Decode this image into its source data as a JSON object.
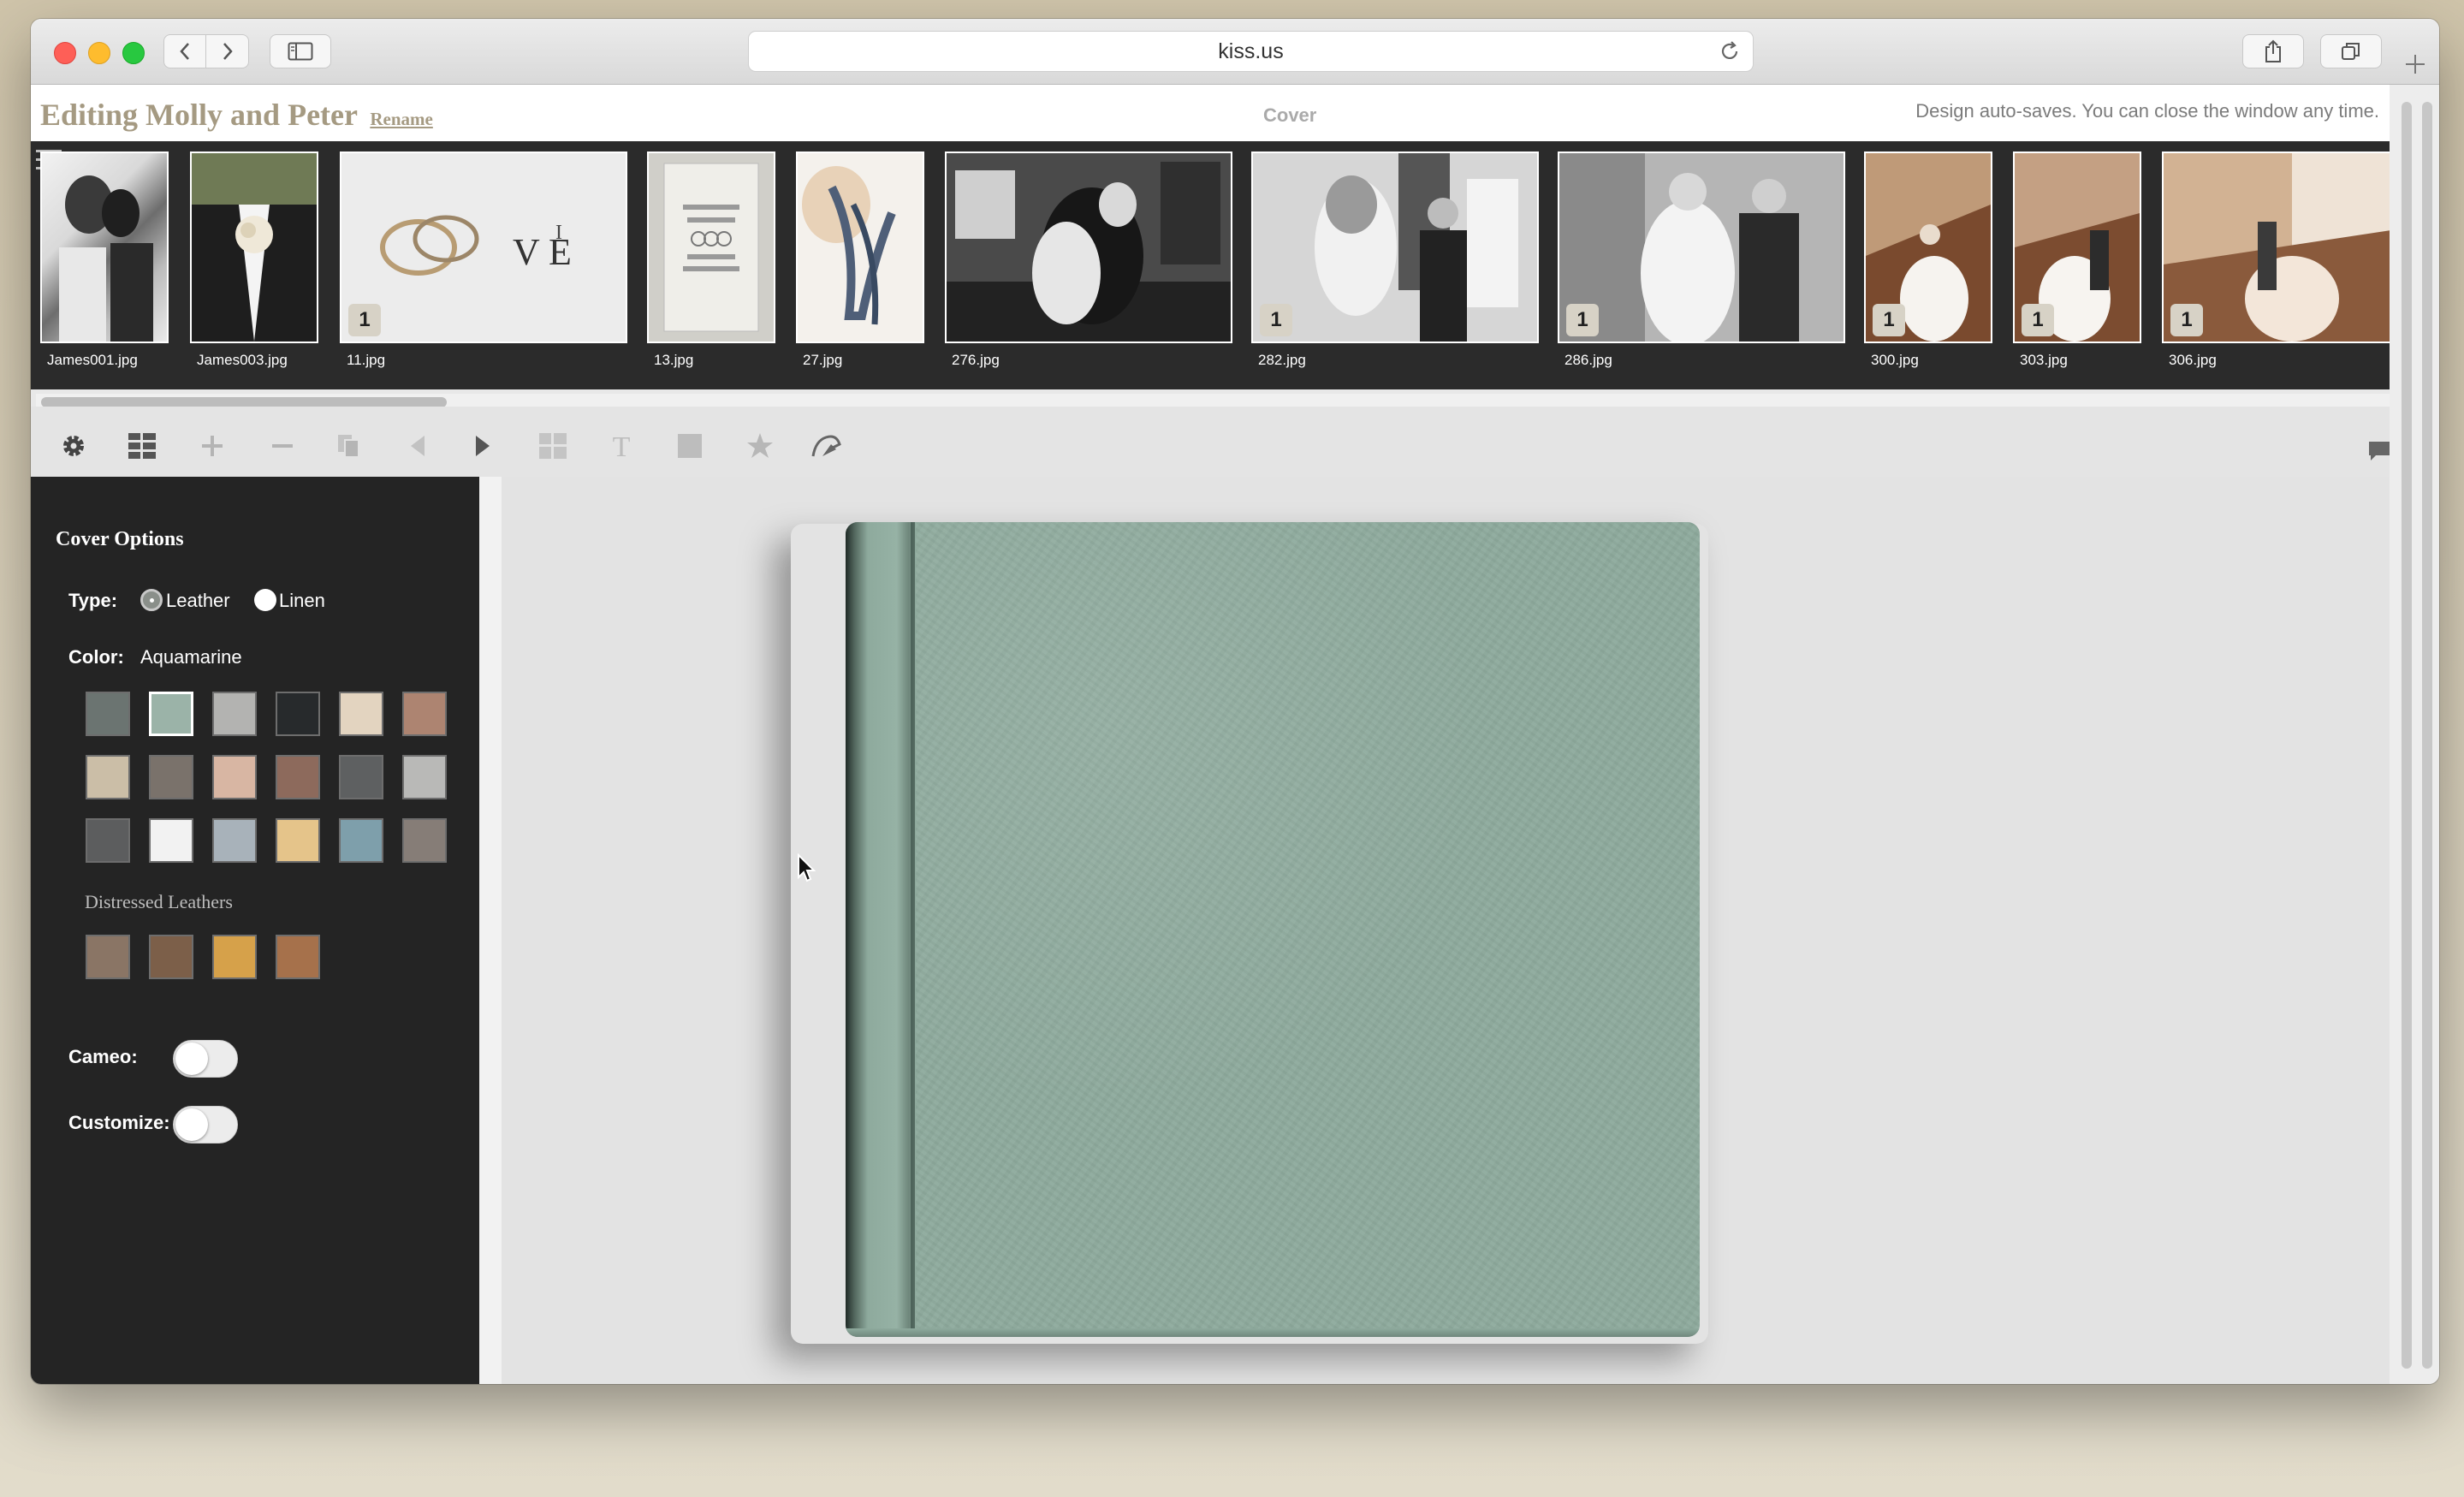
{
  "browser": {
    "url": "kiss.us"
  },
  "app": {
    "title": "Editing Molly and Peter",
    "rename_label": "Rename",
    "page_label": "Cover",
    "autosave_text": "Design auto-saves. You can close the window any time."
  },
  "thumbnails": [
    {
      "file": "James001.jpg",
      "badge": ""
    },
    {
      "file": "James003.jpg",
      "badge": ""
    },
    {
      "file": "11.jpg",
      "badge": "1"
    },
    {
      "file": "13.jpg",
      "badge": ""
    },
    {
      "file": "27.jpg",
      "badge": ""
    },
    {
      "file": "276.jpg",
      "badge": ""
    },
    {
      "file": "282.jpg",
      "badge": "1"
    },
    {
      "file": "286.jpg",
      "badge": "1"
    },
    {
      "file": "300.jpg",
      "badge": "1"
    },
    {
      "file": "303.jpg",
      "badge": "1"
    },
    {
      "file": "306.jpg",
      "badge": "1"
    }
  ],
  "toolbar": {
    "icons": [
      "gear-icon",
      "grid-icon",
      "plus-icon",
      "minus-icon",
      "copy-icon",
      "prev-icon",
      "next-icon",
      "layout-icon",
      "text-icon",
      "box-icon",
      "star-icon",
      "signature-icon"
    ]
  },
  "panel": {
    "title": "Cover Options",
    "type_label": "Type:",
    "type_options": [
      "Leather",
      "Linen"
    ],
    "type_selected": "Leather",
    "color_label": "Color:",
    "color_value": "Aquamarine",
    "colors": [
      "#6b7471",
      "#9bb3a8",
      "#b3b3b1",
      "#272a2c",
      "#e3d4c0",
      "#ad8471",
      "#cbbea7",
      "#7a726b",
      "#d8b6a3",
      "#8d6a5c",
      "#5e6061",
      "#b9b9b7",
      "#5c5d5e",
      "#f2f2f2",
      "#a8b2ba",
      "#e5c48a",
      "#7e9fab",
      "#867d77"
    ],
    "selected_color_index": 1,
    "distressed_label": "Distressed Leathers",
    "distressed_colors": [
      "#8a7565",
      "#7c5f49",
      "#d6a14a",
      "#a6714b"
    ],
    "cameo_label": "Cameo:",
    "cameo_on": false,
    "customize_label": "Customize:",
    "customize_on": false
  },
  "book": {
    "cover_color": "#8eaa9d"
  }
}
